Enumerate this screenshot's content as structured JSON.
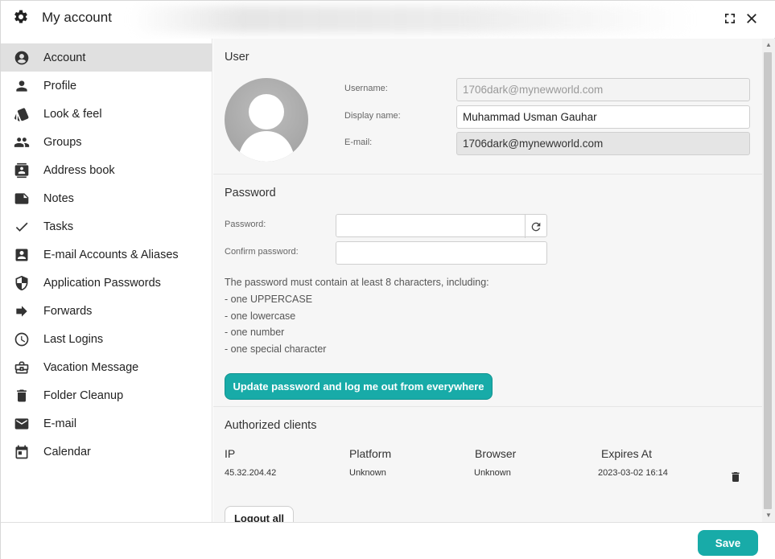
{
  "window": {
    "title": "My account"
  },
  "sidebar": {
    "items": [
      {
        "label": "Account",
        "icon": "account-circle-icon",
        "active": true
      },
      {
        "label": "Profile",
        "icon": "person-icon"
      },
      {
        "label": "Look & feel",
        "icon": "style-icon"
      },
      {
        "label": "Groups",
        "icon": "group-icon"
      },
      {
        "label": "Address book",
        "icon": "contacts-icon"
      },
      {
        "label": "Notes",
        "icon": "note-icon"
      },
      {
        "label": "Tasks",
        "icon": "check-icon"
      },
      {
        "label": "E-mail Accounts & Aliases",
        "icon": "account-box-icon"
      },
      {
        "label": "Application Passwords",
        "icon": "shield-icon"
      },
      {
        "label": "Forwards",
        "icon": "arrow-forward-icon"
      },
      {
        "label": "Last Logins",
        "icon": "clock-icon"
      },
      {
        "label": "Vacation Message",
        "icon": "briefcase-icon"
      },
      {
        "label": "Folder Cleanup",
        "icon": "trash-icon"
      },
      {
        "label": "E-mail",
        "icon": "mail-icon"
      },
      {
        "label": "Calendar",
        "icon": "calendar-icon"
      }
    ]
  },
  "user": {
    "section_title": "User",
    "username_label": "Username:",
    "username_value": "1706dark@mynewworld.com",
    "display_name_label": "Display name:",
    "display_name_value": "Muhammad Usman Gauhar",
    "email_label": "E-mail:",
    "email_value": "1706dark@mynewworld.com"
  },
  "password": {
    "section_title": "Password",
    "password_label": "Password:",
    "confirm_label": "Confirm password:",
    "hint_lines": [
      "The password must contain at least 8 characters, including:",
      "- one UPPERCASE",
      "- one lowercase",
      "- one number",
      "- one special character"
    ],
    "update_button": "Update password and log me out from everywhere"
  },
  "clients": {
    "section_title": "Authorized clients",
    "columns": [
      "IP",
      "Platform",
      "Browser",
      "Expires At"
    ],
    "rows": [
      {
        "ip": "45.32.204.42",
        "platform": "Unknown",
        "browser": "Unknown",
        "expires": "2023-03-02 16:14"
      }
    ],
    "logout_all_button": "Logout all"
  },
  "footer": {
    "save_button": "Save"
  },
  "colors": {
    "accent": "#18aba8",
    "active_item_bg": "#e0e0e0"
  }
}
